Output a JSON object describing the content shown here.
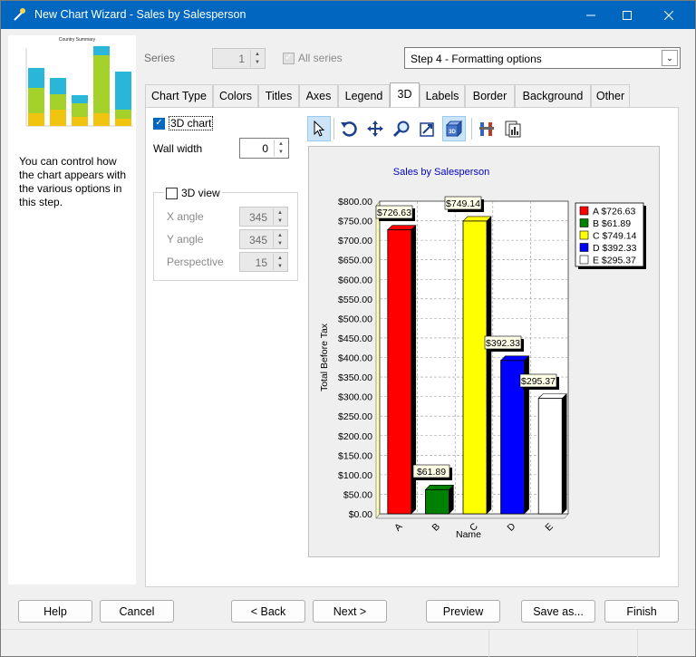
{
  "window": {
    "title": "New Chart Wizard - Sales by Salesperson"
  },
  "left": {
    "thumb_title": "Country Summary",
    "description": "You can control how the chart appears with the various options in this step."
  },
  "series": {
    "label": "Series",
    "value": "1",
    "all_series_label": "All series",
    "all_series_checked": true
  },
  "step": {
    "selected": "Step 4 - Formatting options"
  },
  "tabs": [
    "Chart Type",
    "Colors",
    "Titles",
    "Axes",
    "Legend",
    "3D",
    "Labels",
    "Border",
    "Background",
    "Other"
  ],
  "active_tab": "3D",
  "three_d": {
    "chart_label": "3D chart",
    "chart_checked": true,
    "wall_width_label": "Wall width",
    "wall_width": "0",
    "view_label": "3D view",
    "view_checked": false,
    "x_angle_label": "X angle",
    "x_angle": "345",
    "y_angle_label": "Y angle",
    "y_angle": "345",
    "perspective_label": "Perspective",
    "perspective": "15"
  },
  "toolbar": [
    "pointer-icon",
    "rotate-icon",
    "move-icon",
    "zoom-icon",
    "depth-icon",
    "3d-icon",
    "edit-icon",
    "data-icon"
  ],
  "chart_data": {
    "type": "bar",
    "title": "Sales by Salesperson",
    "xlabel": "Name",
    "ylabel": "Total Before Tax",
    "categories": [
      "A",
      "B",
      "C",
      "D",
      "E"
    ],
    "values": [
      726.63,
      61.89,
      749.14,
      392.33,
      295.37
    ],
    "data_labels": [
      "$726.63",
      "$61.89",
      "$749.14",
      "$392.33",
      "$295.37"
    ],
    "colors": [
      "#ff0000",
      "#008000",
      "#ffff00",
      "#0000ff",
      "#ffffff"
    ],
    "ylim": [
      0,
      800
    ],
    "yticks": [
      "$0.00",
      "$50.00",
      "$100.00",
      "$150.00",
      "$200.00",
      "$250.00",
      "$300.00",
      "$350.00",
      "$400.00",
      "$450.00",
      "$500.00",
      "$550.00",
      "$600.00",
      "$650.00",
      "$700.00",
      "$750.00",
      "$800.00"
    ],
    "legend": [
      "A  $726.63",
      "B    $61.89",
      "C  $749.14",
      "D  $392.33",
      "E  $295.37"
    ],
    "legend_position": "top-right",
    "grid": true,
    "title_color": "#0000cc"
  },
  "buttons": {
    "help": "Help",
    "cancel": "Cancel",
    "back": "< Back",
    "next": "Next >",
    "preview": "Preview",
    "save_as": "Save as...",
    "finish": "Finish"
  }
}
